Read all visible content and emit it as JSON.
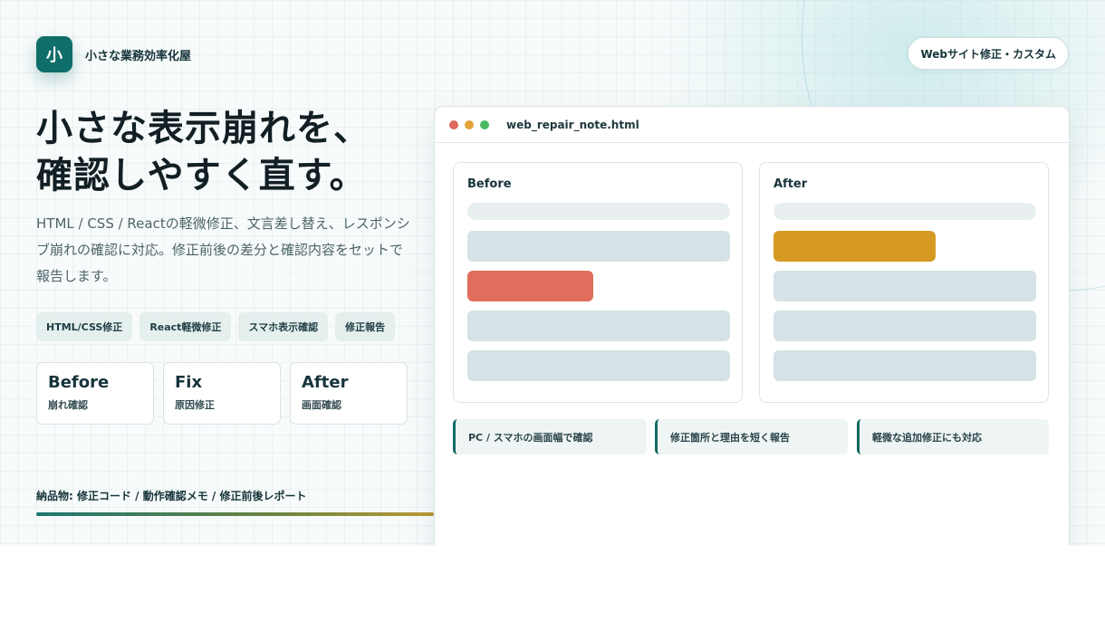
{
  "brand": {
    "logo_char": "小",
    "name": "小さな業務効率化屋"
  },
  "service_pill": "Webサイト修正・カスタム",
  "headline": {
    "line1": "小さな表示崩れを、",
    "line2": "確認しやすく直す。"
  },
  "description": "HTML / CSS / Reactの軽微修正、文言差し替え、レスポンシブ崩れの確認に対応。修正前後の差分と確認内容をセットで報告します。",
  "tags": [
    "HTML/CSS修正",
    "React軽微修正",
    "スマホ表示確認",
    "修正報告"
  ],
  "steps": [
    {
      "title": "Before",
      "subtitle": "崩れ確認"
    },
    {
      "title": "Fix",
      "subtitle": "原因修正"
    },
    {
      "title": "After",
      "subtitle": "画面確認"
    }
  ],
  "deliverables": "納品物: 修正コード / 動作確認メモ / 修正前後レポート",
  "progress": 0.385,
  "window": {
    "filename": "web_repair_note.html",
    "dots": [
      "#e0675a",
      "#e2a339",
      "#49b864"
    ],
    "before_label": "Before",
    "after_label": "After",
    "notes": [
      "PC / スマホの画面幅で確認",
      "修正箇所と理由を短く報告",
      "軽微な追加修正にも対応"
    ]
  },
  "colors": {
    "brand_teal": "#0f6e6a",
    "error_red": "#df6e5c",
    "fixed_gold": "#d69a24",
    "skeleton": "#d5e2e6",
    "skeleton_light": "#e9eff1"
  }
}
